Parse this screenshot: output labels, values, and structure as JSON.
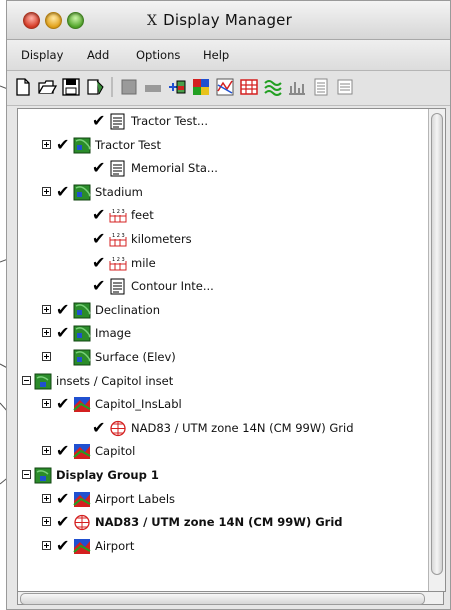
{
  "window": {
    "title": "Display Manager"
  },
  "menubar": {
    "items": [
      "Display",
      "Add",
      "Options",
      "Help"
    ]
  },
  "toolbar": {
    "buttons": [
      "new-icon",
      "open-icon",
      "save-icon",
      "clear-icon",
      "grid-icon",
      "legend-icon",
      "add-layer-icon",
      "raster-icon",
      "vector-icon",
      "grid-layer-icon",
      "contour-icon",
      "histogram-icon",
      "table-icon",
      "text-icon"
    ]
  },
  "tree": {
    "rows": [
      {
        "label": "Tractor Test...",
        "checked": true,
        "icon": "text-layer-icon",
        "expander": "",
        "bold": false
      },
      {
        "label": "Tractor Test",
        "checked": true,
        "icon": "raster-map-icon",
        "expander": "plus",
        "bold": false
      },
      {
        "label": "Memorial Sta...",
        "checked": true,
        "icon": "text-layer-icon",
        "expander": "",
        "bold": false
      },
      {
        "label": "Stadium",
        "checked": true,
        "icon": "raster-map-icon",
        "expander": "plus",
        "bold": false
      },
      {
        "label": "feet",
        "checked": true,
        "icon": "scalebar-icon",
        "expander": "",
        "bold": false
      },
      {
        "label": "kilometers",
        "checked": true,
        "icon": "scalebar-icon",
        "expander": "",
        "bold": false
      },
      {
        "label": "mile",
        "checked": true,
        "icon": "scalebar-icon",
        "expander": "",
        "bold": false
      },
      {
        "label": "Contour Inte...",
        "checked": true,
        "icon": "text-layer-icon",
        "expander": "",
        "bold": false
      },
      {
        "label": "Declination",
        "checked": true,
        "icon": "raster-map-icon",
        "expander": "plus",
        "bold": false
      },
      {
        "label": "Image",
        "checked": true,
        "icon": "raster-map-icon",
        "expander": "plus",
        "bold": false
      },
      {
        "label": "Surface (Elev)",
        "checked": false,
        "icon": "raster-map-icon",
        "expander": "plus",
        "bold": false
      },
      {
        "label": "insets / Capitol inset",
        "checked": false,
        "icon": "group-icon",
        "expander": "minus",
        "bold": false
      },
      {
        "label": "Capitol_InsLabl",
        "checked": true,
        "icon": "vector-map-icon",
        "expander": "plus",
        "bold": false
      },
      {
        "label": "NAD83 / UTM zone 14N (CM 99W) Grid",
        "checked": true,
        "icon": "grid-layer-icon",
        "expander": "",
        "bold": false
      },
      {
        "label": "Capitol",
        "checked": true,
        "icon": "vector-map-icon",
        "expander": "plus",
        "bold": false
      },
      {
        "label": "Display Group 1",
        "checked": false,
        "icon": "group-icon",
        "expander": "minus",
        "bold": true
      },
      {
        "label": "Airport Labels",
        "checked": true,
        "icon": "vector-map-icon",
        "expander": "plus",
        "bold": false
      },
      {
        "label": "NAD83 / UTM zone 14N (CM 99W) Grid",
        "checked": true,
        "icon": "grid-layer-icon",
        "expander": "plus",
        "bold": true
      },
      {
        "label": "Airport",
        "checked": true,
        "icon": "vector-map-icon",
        "expander": "plus",
        "bold": false
      }
    ]
  },
  "colors": {
    "accent_red": "#d42020",
    "accent_green": "#22a022",
    "accent_blue": "#2050d0"
  }
}
